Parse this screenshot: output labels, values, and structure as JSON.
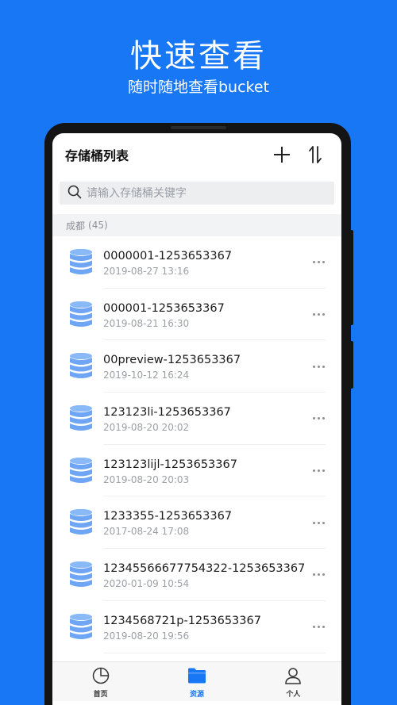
{
  "hero": {
    "title": "快速查看",
    "subtitle": "随时随地查看bucket"
  },
  "header": {
    "title": "存储桶列表",
    "add_icon": "plus-icon",
    "sort_icon": "sort-icon"
  },
  "search": {
    "placeholder": "请输入存储桶关键字",
    "icon": "search-icon"
  },
  "section": {
    "label": "成都",
    "count": "(45)"
  },
  "buckets": [
    {
      "name": "0000001-1253653367",
      "date": "2019-08-27 13:16"
    },
    {
      "name": "000001-1253653367",
      "date": "2019-08-21 16:30"
    },
    {
      "name": "00preview-1253653367",
      "date": "2019-10-12 16:24"
    },
    {
      "name": "123123li-1253653367",
      "date": "2019-08-20 20:02"
    },
    {
      "name": "123123lijl-1253653367",
      "date": "2019-08-20 20:03"
    },
    {
      "name": "1233355-1253653367",
      "date": "2017-08-24 17:08"
    },
    {
      "name": "12345566677754322-1253653367",
      "date": "2020-01-09 10:54"
    },
    {
      "name": "1234568721p-1253653367",
      "date": "2019-08-20 19:56"
    }
  ],
  "tabs": [
    {
      "label": "首页",
      "icon": "pie-chart-icon",
      "active": false
    },
    {
      "label": "资源",
      "icon": "folder-icon",
      "active": true
    },
    {
      "label": "个人",
      "icon": "person-icon",
      "active": false
    }
  ],
  "colors": {
    "brand": "#1777f5",
    "bucket_icon": "#6ea6f5"
  }
}
